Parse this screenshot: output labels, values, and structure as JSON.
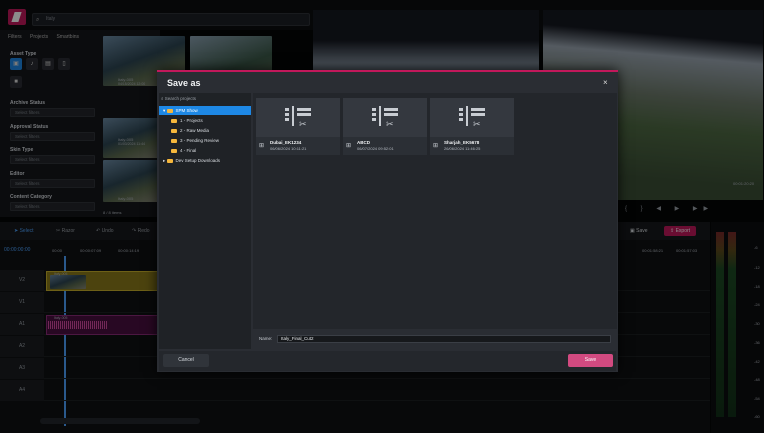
{
  "app": {
    "search_value": "Italy"
  },
  "left_panel": {
    "tabs": [
      "Filters",
      "Projects",
      "Smartbins"
    ],
    "asset_type_label": "Asset Type",
    "filters": [
      {
        "label": "Archive Status",
        "placeholder": "Select filters"
      },
      {
        "label": "Approval Status",
        "placeholder": "Select filters"
      },
      {
        "label": "Skin Type",
        "placeholder": "Select filters"
      },
      {
        "label": "Editor",
        "placeholder": "Select filters"
      },
      {
        "label": "Content Category",
        "placeholder": "Select filters"
      }
    ],
    "items_count": "8 / 8 items",
    "thumbs": [
      {
        "name": "Italy-005",
        "date": "04/15/2024 12:00"
      },
      {
        "name": "Italy-005",
        "date": "01/03/2024 11:44"
      },
      {
        "name": "Italy-005",
        "date": ""
      }
    ]
  },
  "timeline": {
    "tools": [
      "Select",
      "Razor",
      "Undo",
      "Redo"
    ],
    "timecode": "00:00:00:00",
    "ruler": [
      "00:00",
      "00:00:07:09",
      "00:00:14:19"
    ],
    "ruler_right": [
      "00:01:58:21",
      "00:01:57:03"
    ],
    "right_timecode": "00:01:20:20",
    "save_label": "Save",
    "export_label": "Export",
    "tracks": [
      "V2",
      "V1",
      "A1",
      "A2",
      "A3",
      "A4"
    ],
    "clip_label_v2": "Italy-005",
    "clip_label_a1": "Italy-005",
    "meter_scale": [
      "-6",
      "-12",
      "-18",
      "-24",
      "-30",
      "-36",
      "-42",
      "-48",
      "-54",
      "-60"
    ]
  },
  "dialog": {
    "title": "Save as",
    "close_label": "×",
    "tree_search_placeholder": "Search projects",
    "tree": [
      {
        "label": "SPM Show",
        "selected": true,
        "level": 0
      },
      {
        "label": "1 - Projects",
        "selected": false,
        "level": 1
      },
      {
        "label": "2 - Raw Media",
        "selected": false,
        "level": 1
      },
      {
        "label": "3 - Pending Review",
        "selected": false,
        "level": 1
      },
      {
        "label": "4 - Final",
        "selected": false,
        "level": 1
      },
      {
        "label": "Dev Setup Downloads",
        "selected": false,
        "level": 0
      }
    ],
    "cards": [
      {
        "name": "Dubai_EK1234",
        "date": "06/06/2024 10:11:21"
      },
      {
        "name": "ABCD",
        "date": "06/07/2024 09:52:01"
      },
      {
        "name": "Sharjah_EK5678",
        "date": "26/06/2024 11:46:25"
      }
    ],
    "name_label": "Name:",
    "name_value": "Italy_Final_Cut2",
    "cancel_label": "Cancel",
    "save_label": "Save"
  },
  "colors": {
    "accent": "#c2185b",
    "selection": "#1e88e5",
    "save_button": "#d24a80",
    "folder": "#f6b73c"
  }
}
